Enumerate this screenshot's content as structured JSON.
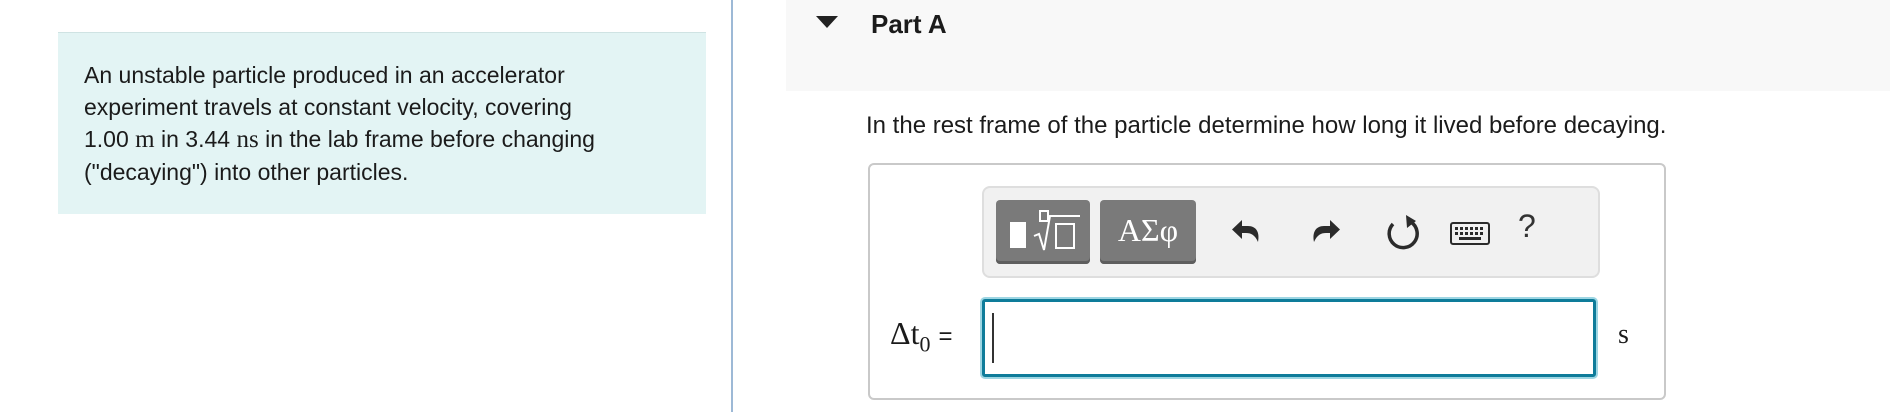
{
  "problem": {
    "line1": "An unstable particle produced in an accelerator",
    "line2": "experiment travels at constant velocity, covering",
    "distance_value": "1.00",
    "distance_unit": "m",
    "line3_mid": "in 3.44",
    "time_unit": "ns",
    "line3_end": "in the lab frame before changing",
    "line4": "(\"decaying\") into other particles."
  },
  "part": {
    "title": "Part A",
    "question": "In the rest frame of the particle determine how long it lived before decaying."
  },
  "toolbar": {
    "symbols_label": "ΑΣφ",
    "help_label": "?",
    "icons": [
      "templates-icon",
      "undo-icon",
      "redo-icon",
      "reset-icon",
      "keyboard-icon",
      "help-icon"
    ]
  },
  "answer": {
    "variable_symbol": "Δt",
    "variable_subscript": "0",
    "equals": "=",
    "value": "",
    "unit": "s"
  },
  "colors": {
    "problem_bg": "#e3f4f4",
    "input_border": "#0e7c9a",
    "tool_btn": "#7a7a7a",
    "divider": "#9db9d6"
  }
}
